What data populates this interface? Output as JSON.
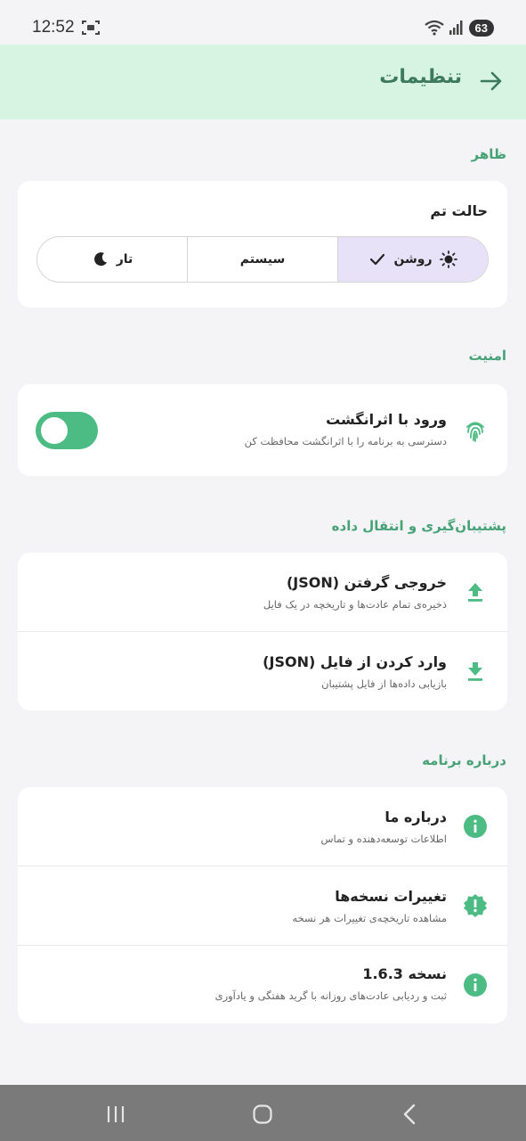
{
  "status_bar": {
    "time": "12:52",
    "battery": "63"
  },
  "app_bar": {
    "title": "تنظیمات"
  },
  "appearance": {
    "section_title": "ظاهر",
    "theme_label": "حالت تم",
    "options": [
      {
        "label": "روشن",
        "selected": true
      },
      {
        "label": "سیستم",
        "selected": false
      },
      {
        "label": "تار",
        "selected": false
      }
    ]
  },
  "security": {
    "section_title": "امنیت",
    "fingerprint_title": "ورود با اثرانگشت",
    "fingerprint_subtitle": "دسترسی به برنامه را با اثرانگشت محافظت کن",
    "fingerprint_enabled": true
  },
  "backup": {
    "section_title": "پشتیبان‌گیری و انتقال داده",
    "export_title": "خروجی گرفتن (JSON)",
    "export_subtitle": "ذخیره‌ی تمام عادت‌ها و تاریخچه در یک فایل",
    "import_title": "وارد کردن از فایل (JSON)",
    "import_subtitle": "بازیابی داده‌ها از فایل پشتیبان"
  },
  "about": {
    "section_title": "درباره برنامه",
    "about_title": "درباره ما",
    "about_subtitle": "اطلاعات توسعه‌دهنده و تماس",
    "changelog_title": "تغییرات نسخه‌ها",
    "changelog_subtitle": "مشاهده تاریخچه‌ی تغییرات هر نسخه",
    "version_title": "نسخه 1.6.3",
    "version_subtitle": "ثبت و ردیابی عادت‌های روزانه با گرید هفتگی و یادآوری"
  },
  "colors": {
    "accent": "#4dbb84",
    "header_bg": "#d7f3e2",
    "section_title": "#47a277",
    "selected_segment": "#e8e2f8"
  },
  "icons": [
    "screenshot-icon",
    "wifi-icon",
    "signal-icon",
    "back-arrow-icon",
    "sun-icon",
    "check-icon",
    "moon-icon",
    "fingerprint-icon",
    "upload-icon",
    "download-icon",
    "info-icon",
    "badge-alert-icon",
    "recents-icon",
    "home-icon",
    "back-icon"
  ]
}
